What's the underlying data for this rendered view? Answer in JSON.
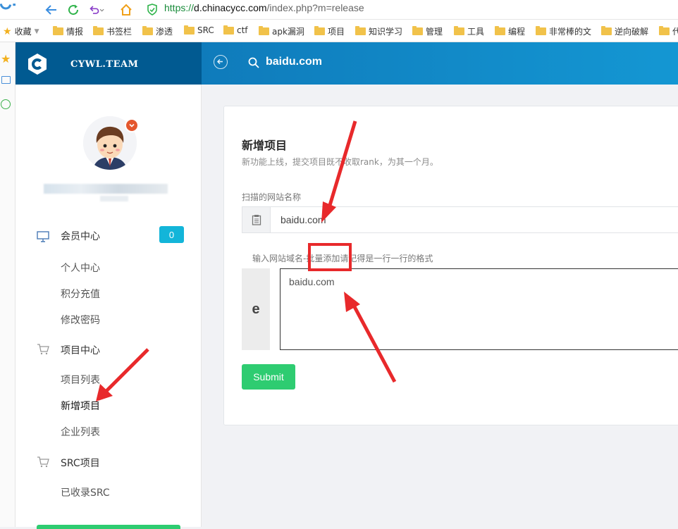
{
  "browser": {
    "url_prefix": "https://",
    "url_host": "d.chinacycc.com",
    "url_path": "/index.php?m=release",
    "bookmarks": {
      "favorites_label": "收藏",
      "items": [
        "情报",
        "书签栏",
        "渗透",
        "SRC",
        "ctf",
        "apk漏洞",
        "项目",
        "知识学习",
        "管理",
        "工具",
        "编程",
        "非常棒的文",
        "逆向破解",
        "代"
      ]
    }
  },
  "app": {
    "brand": "CYWL.TEAM",
    "header_search_text": "baidu.com"
  },
  "sidebar": {
    "member_center": "会员中心",
    "member_badge": "0",
    "member_items": [
      "个人中心",
      "积分充值",
      "修改密码"
    ],
    "project_center": "项目中心",
    "project_items": [
      "项目列表",
      "新增项目",
      "企业列表"
    ],
    "src_project": "SRC项目",
    "src_items": [
      "已收录SRC"
    ]
  },
  "form": {
    "title": "新增项目",
    "subtitle": "新功能上线，提交项目既不收取rank，为其一个月。",
    "site_name_label": "扫描的网站名称",
    "site_name_value": "baidu.com",
    "domains_label": "输入网站域名-批量添加请记得是一行一行的格式",
    "domains_addon": "e",
    "domains_value": "baidu.com",
    "submit_label": "Submit"
  },
  "colors": {
    "brand_bg": "#015a91",
    "header_bg": "#1497d3",
    "accent_green": "#2ecc71",
    "badge_cyan": "#13b5d9",
    "annotation_red": "#e8292b"
  }
}
